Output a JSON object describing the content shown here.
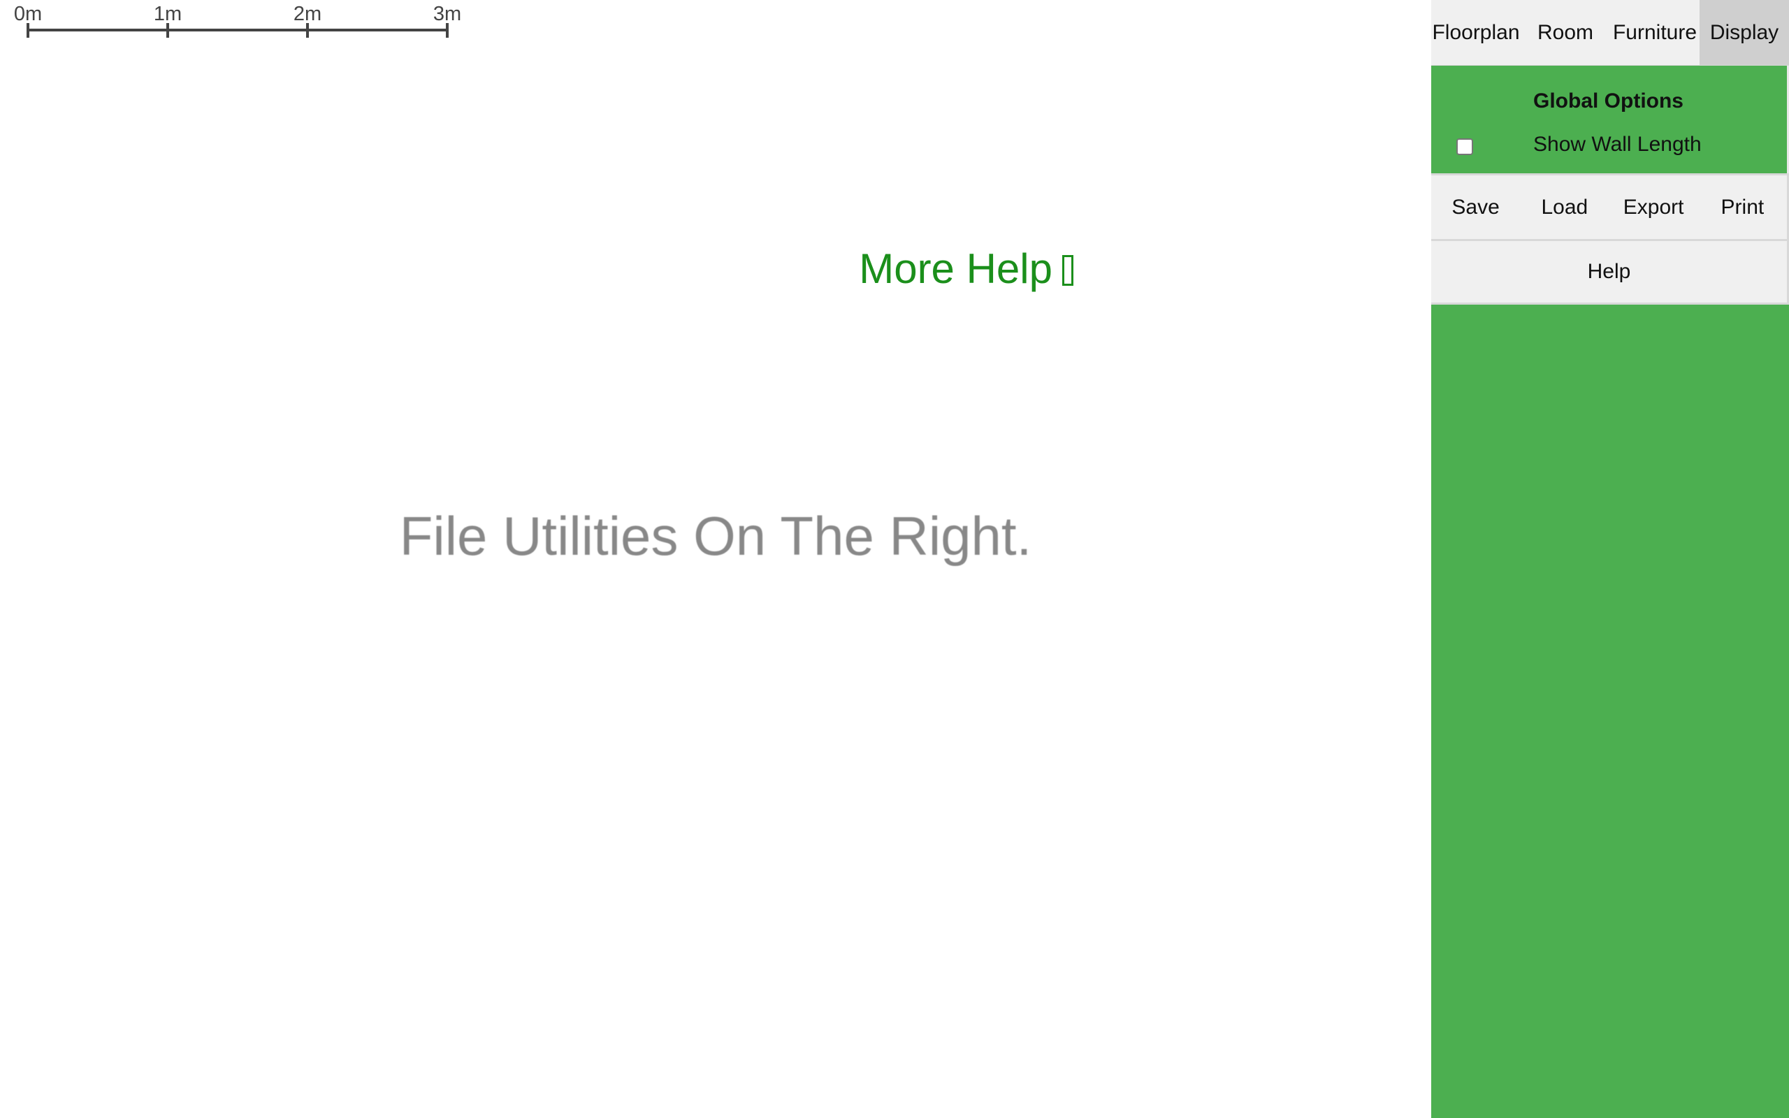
{
  "scale_bar": {
    "labels": [
      "0m",
      "1m",
      "2m",
      "3m"
    ]
  },
  "canvas": {
    "hint_text": "File Utilities On The Right.",
    "more_help_label": "More Help"
  },
  "sidebar": {
    "tabs": [
      {
        "label": "Floorplan"
      },
      {
        "label": "Room"
      },
      {
        "label": "Furniture"
      },
      {
        "label": "Display",
        "active": true
      }
    ],
    "global_options": {
      "title": "Global Options",
      "show_wall_length_label": "Show Wall Length",
      "show_wall_length_checked": false
    },
    "file_buttons": [
      {
        "label": "Save"
      },
      {
        "label": "Load"
      },
      {
        "label": "Export"
      },
      {
        "label": "Print"
      }
    ],
    "help_button": {
      "label": "Help"
    }
  },
  "colors": {
    "sidebar_background": "#4caf50",
    "more_help_text": "#1b8f1b",
    "hint_text": "#888888",
    "active_tab": "#cfcfcf"
  }
}
